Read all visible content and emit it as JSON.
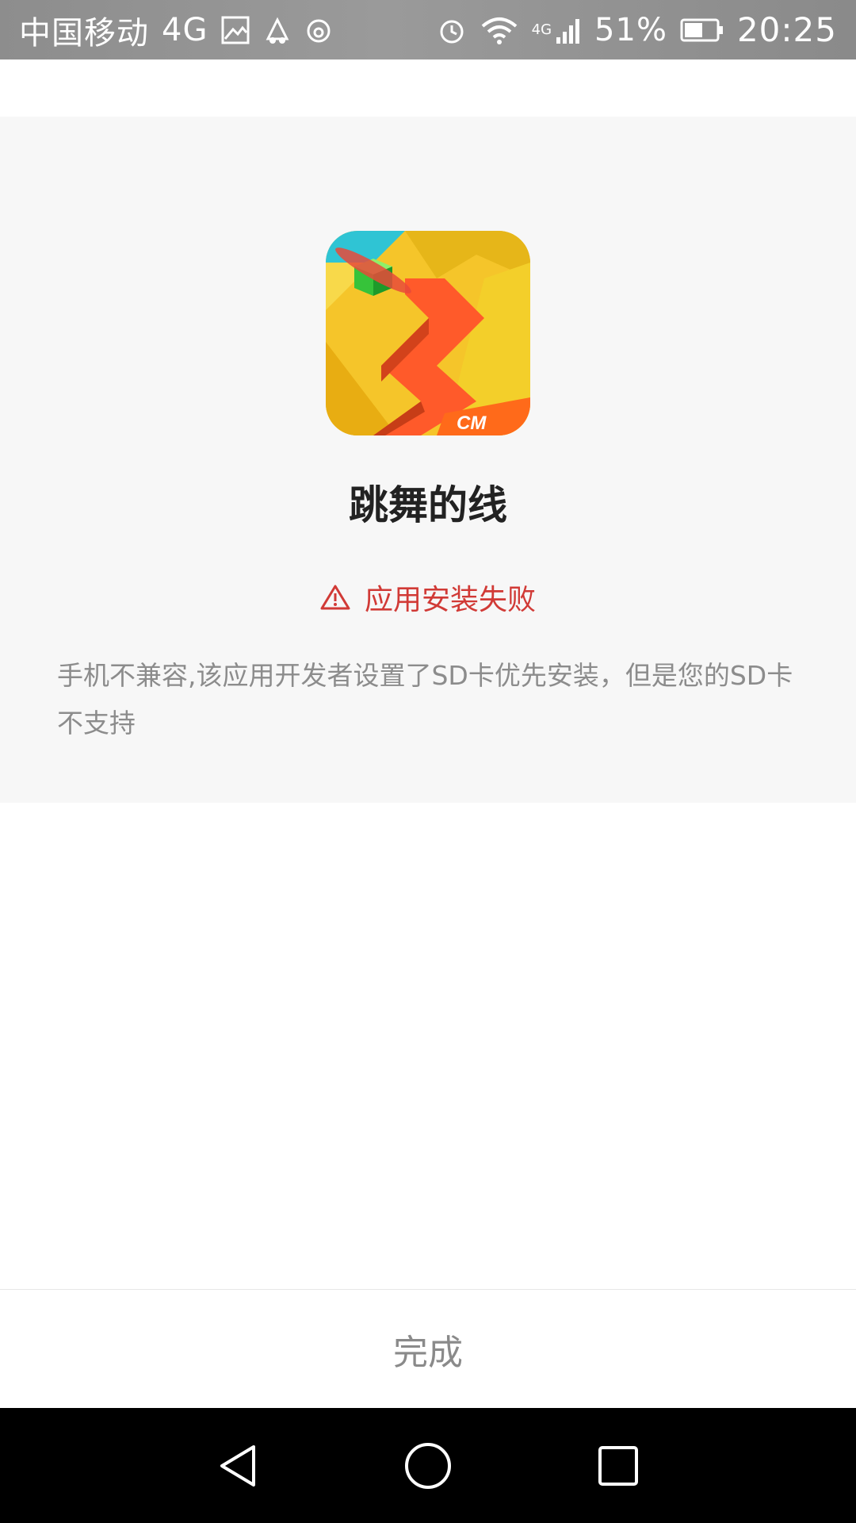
{
  "status_bar": {
    "carrier": "中国移动",
    "network": "4G",
    "signal_label": "4G",
    "battery": "51%",
    "time": "20:25",
    "icons": [
      "image-icon",
      "app-notify-icon",
      "netease-music-icon",
      "alarm-icon",
      "wifi-icon",
      "cell-signal-icon",
      "battery-icon"
    ]
  },
  "app": {
    "name": "跳舞的线",
    "icon": "dancing-line-app-icon"
  },
  "install_status": {
    "text": "应用安装失败",
    "icon": "warning-icon",
    "color": "#d13a36"
  },
  "description": "手机不兼容,该应用开发者设置了SD卡优先安装，但是您的SD卡不支持",
  "actions": {
    "done_label": "完成"
  },
  "nav_bar": {
    "icons": [
      "back-icon",
      "home-icon",
      "recents-icon"
    ]
  }
}
